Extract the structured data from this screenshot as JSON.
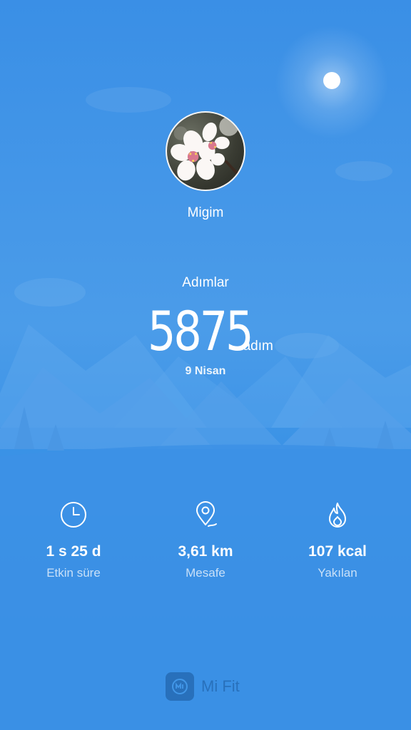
{
  "profile": {
    "name": "Migim"
  },
  "steps": {
    "label": "Adımlar",
    "value": "5875",
    "unit": "adım",
    "date": "9 Nisan"
  },
  "stats": [
    {
      "icon": "clock-icon",
      "value": "1 s 25 d",
      "label": "Etkin süre"
    },
    {
      "icon": "location-pin-icon",
      "value": "3,61 km",
      "label": "Mesafe"
    },
    {
      "icon": "flame-icon",
      "value": "107 kcal",
      "label": "Yakılan"
    }
  ],
  "branding": {
    "app_name": "Mi Fit"
  },
  "colors": {
    "sky_top": "#3a8fe6",
    "ground": "#1f84dd",
    "text": "#ffffff"
  }
}
